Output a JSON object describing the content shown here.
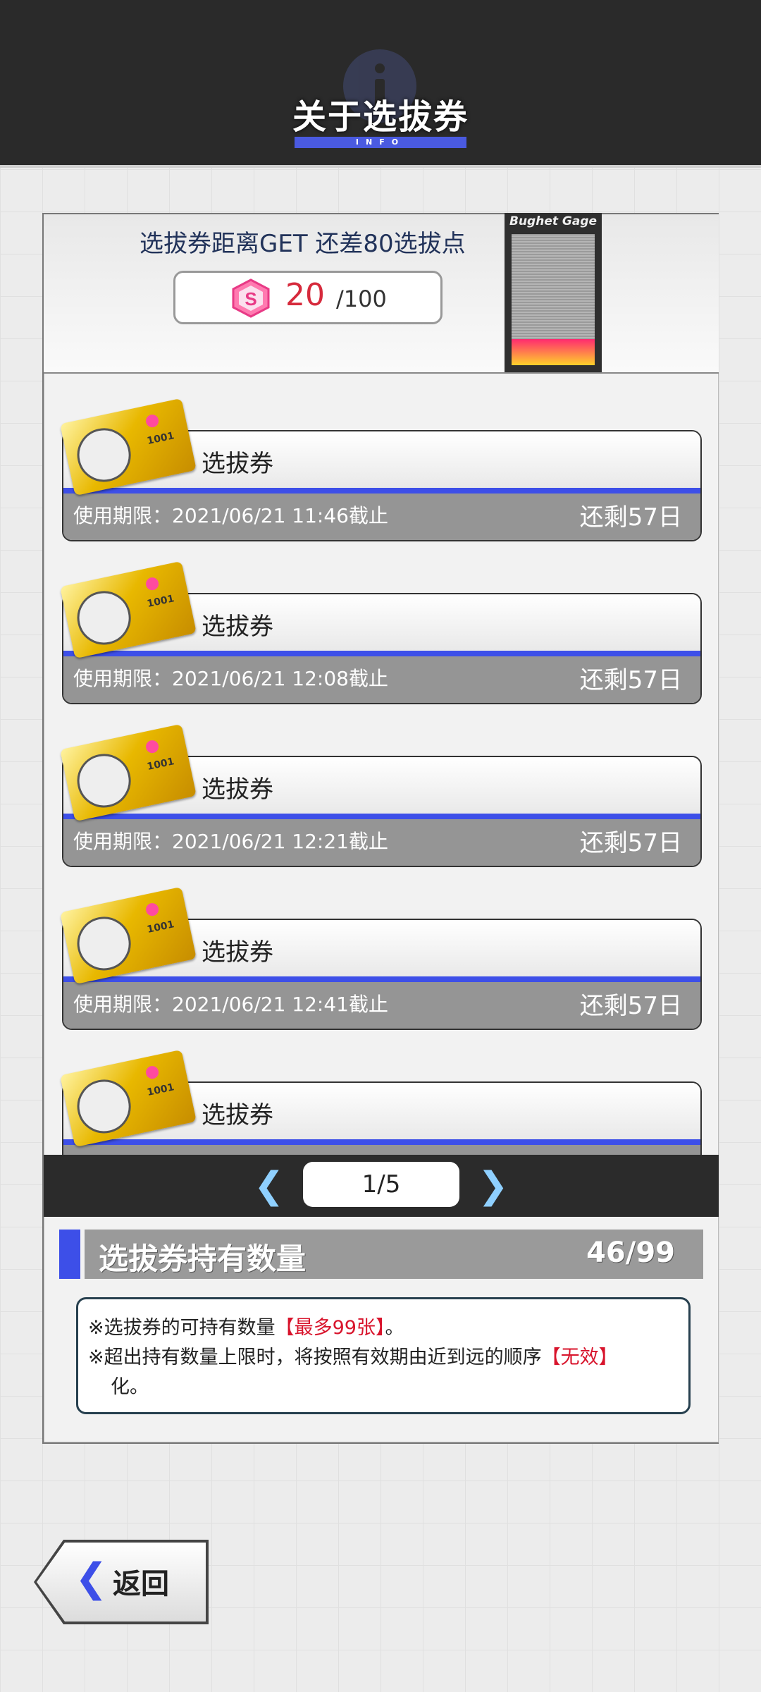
{
  "header": {
    "title": "关于选拔券",
    "subtitle": "INFO"
  },
  "progress": {
    "message": "选拔券距离GET 还差80选拔点",
    "points_icon": "s-badge-icon",
    "points_current": "20",
    "points_max": "/100",
    "gage_label": "Bughet Gage",
    "gage_fill_fraction": 0.2,
    "gage_colors": [
      "#ff2a70",
      "#ffd12a"
    ]
  },
  "tickets": [
    {
      "name": "选拔券",
      "expiry": "使用期限：2021/06/21 11:46截止",
      "remaining": "还剩57日"
    },
    {
      "name": "选拔券",
      "expiry": "使用期限：2021/06/21 12:08截止",
      "remaining": "还剩57日"
    },
    {
      "name": "选拔券",
      "expiry": "使用期限：2021/06/21 12:21截止",
      "remaining": "还剩57日"
    },
    {
      "name": "选拔券",
      "expiry": "使用期限：2021/06/21 12:41截止",
      "remaining": "还剩57日"
    },
    {
      "name": "选拔券",
      "expiry": "",
      "remaining": ""
    }
  ],
  "pagination": {
    "page": "1/5",
    "prev_icon": "chevron-left-icon",
    "next_icon": "chevron-right-icon"
  },
  "holdings": {
    "label": "选拔券持有数量",
    "count": "46/99"
  },
  "notice": {
    "line1_prefix": "※选拔券的可持有数量",
    "line1_highlight": "【最多99张】",
    "line1_suffix": "。",
    "line2_prefix": "※超出持有数量上限时，将按照有效期由近到远的顺序",
    "line2_highlight": "【无效】",
    "line3": "化。"
  },
  "back_button": {
    "label": "返回"
  },
  "colors": {
    "accent_blue": "#3d4fe8",
    "points_red": "#d62a3c",
    "notice_red": "#d8142c"
  }
}
